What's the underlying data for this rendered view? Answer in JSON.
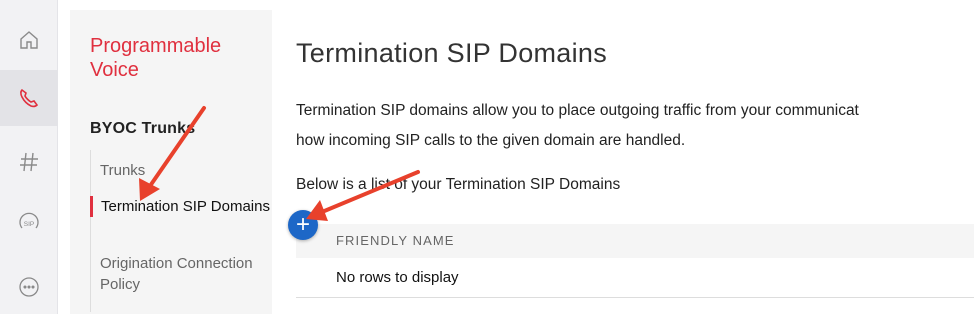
{
  "rail": {
    "items": [
      {
        "icon": "home-icon"
      },
      {
        "icon": "phone-icon"
      },
      {
        "icon": "hash-icon"
      },
      {
        "icon": "sip-icon",
        "label": "SIP"
      },
      {
        "icon": "more-icon"
      }
    ]
  },
  "nav": {
    "title": "Programmable Voice",
    "section": "BYOC Trunks",
    "items": [
      {
        "label": "Trunks"
      },
      {
        "label": "Termination SIP Domains"
      },
      {
        "label": "Origination Connection Policy"
      }
    ]
  },
  "main": {
    "title": "Termination SIP Domains",
    "description_line1": "Termination SIP domains allow you to place outgoing traffic from your communicat",
    "description_line2": "how incoming SIP calls to the given domain are handled.",
    "list_intro": "Below is a list of your Termination SIP Domains",
    "add_label": "+",
    "column_header": "FRIENDLY NAME",
    "empty_message": "No rows to display"
  },
  "colors": {
    "brand_red": "#e0303f",
    "accent_blue": "#1d67c7",
    "arrow_red": "#e8412c"
  }
}
